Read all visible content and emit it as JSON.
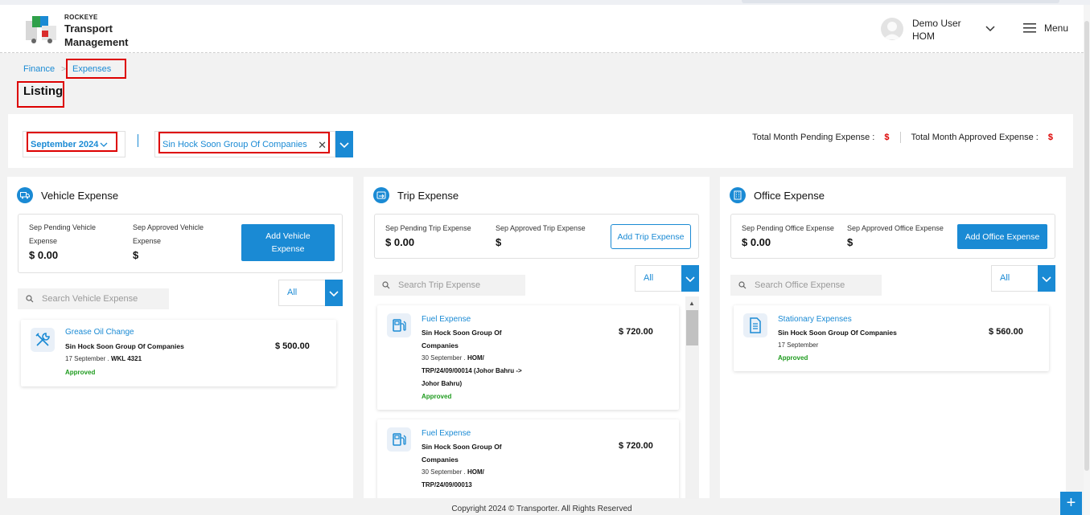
{
  "app": {
    "brand_small": "ROCKEYE",
    "brand_line1": "Transport",
    "brand_line2": "Management"
  },
  "user": {
    "name": "Demo User",
    "branch": "HOM"
  },
  "menu_label": "Menu",
  "breadcrumb": {
    "parent": "Finance",
    "current": "Expenses"
  },
  "page_title": "Listing",
  "filters": {
    "month": "September 2024",
    "company": "Sin Hock Soon Group Of Companies"
  },
  "totals": {
    "pending_label": "Total Month Pending Expense :",
    "pending_value": "$",
    "approved_label": "Total Month Approved Expense :",
    "approved_value": "$"
  },
  "vehicle": {
    "title": "Vehicle Expense",
    "pending_label": "Sep Pending Vehicle Expense",
    "pending_value": "$ 0.00",
    "approved_label": "Sep Approved Vehicle Expense",
    "approved_value": "$",
    "add_label": "Add Vehicle Expense",
    "search_placeholder": "Search Vehicle Expense",
    "filter_value": "All",
    "items": [
      {
        "name": "Grease Oil Change",
        "company": "Sin Hock Soon Group Of Companies",
        "date": "17 September .",
        "ref": "WKL 4321",
        "status": "Approved",
        "amount": "$ 500.00"
      }
    ]
  },
  "trip": {
    "title": "Trip Expense",
    "pending_label": "Sep Pending Trip Expense",
    "pending_value": "$ 0.00",
    "approved_label": "Sep Approved Trip Expense",
    "approved_value": "$",
    "add_label": "Add Trip Expense",
    "search_placeholder": "Search Trip Expense",
    "filter_value": "All",
    "items": [
      {
        "name": "Fuel Expense",
        "company_1": "Sin Hock Soon Group Of",
        "company_2": "Companies",
        "date": "30 September .",
        "ref_1": "HOM/",
        "ref_2": "TRP/24/09/00014 (Johor Bahru ->",
        "ref_3": "Johor Bahru)",
        "status": "Approved",
        "amount": "$ 720.00"
      },
      {
        "name": "Fuel Expense",
        "company_1": "Sin Hock Soon Group Of",
        "company_2": "Companies",
        "date": "30 September .",
        "ref_1": "HOM/",
        "ref_2": "TRP/24/09/00013",
        "amount": "$ 720.00"
      }
    ]
  },
  "office": {
    "title": "Office Expense",
    "pending_label": "Sep Pending Office Expense",
    "pending_value": "$ 0.00",
    "approved_label": "Sep Approved Office Expense",
    "approved_value": "$",
    "add_label": "Add Office Expense",
    "search_placeholder": "Search Office Expense",
    "filter_value": "All",
    "items": [
      {
        "name": "Stationary Expenses",
        "company": "Sin Hock Soon Group Of Companies",
        "date": "17 September",
        "status": "Approved",
        "amount": "$ 560.00"
      }
    ]
  },
  "footer": "Copyright 2024 © Transporter. All Rights Reserved",
  "fab_label": "+",
  "colors": {
    "accent": "#1a8ad4",
    "approved": "#1e9b1e",
    "highlight": "#dd0000",
    "dollar": "#dd0000"
  },
  "icons": {
    "vehicle": "truck-icon",
    "trip": "route-icon",
    "office": "building-icon",
    "vehicle_item": "wrench-icon",
    "trip_item": "fuel-pump-icon",
    "office_item": "document-icon"
  }
}
